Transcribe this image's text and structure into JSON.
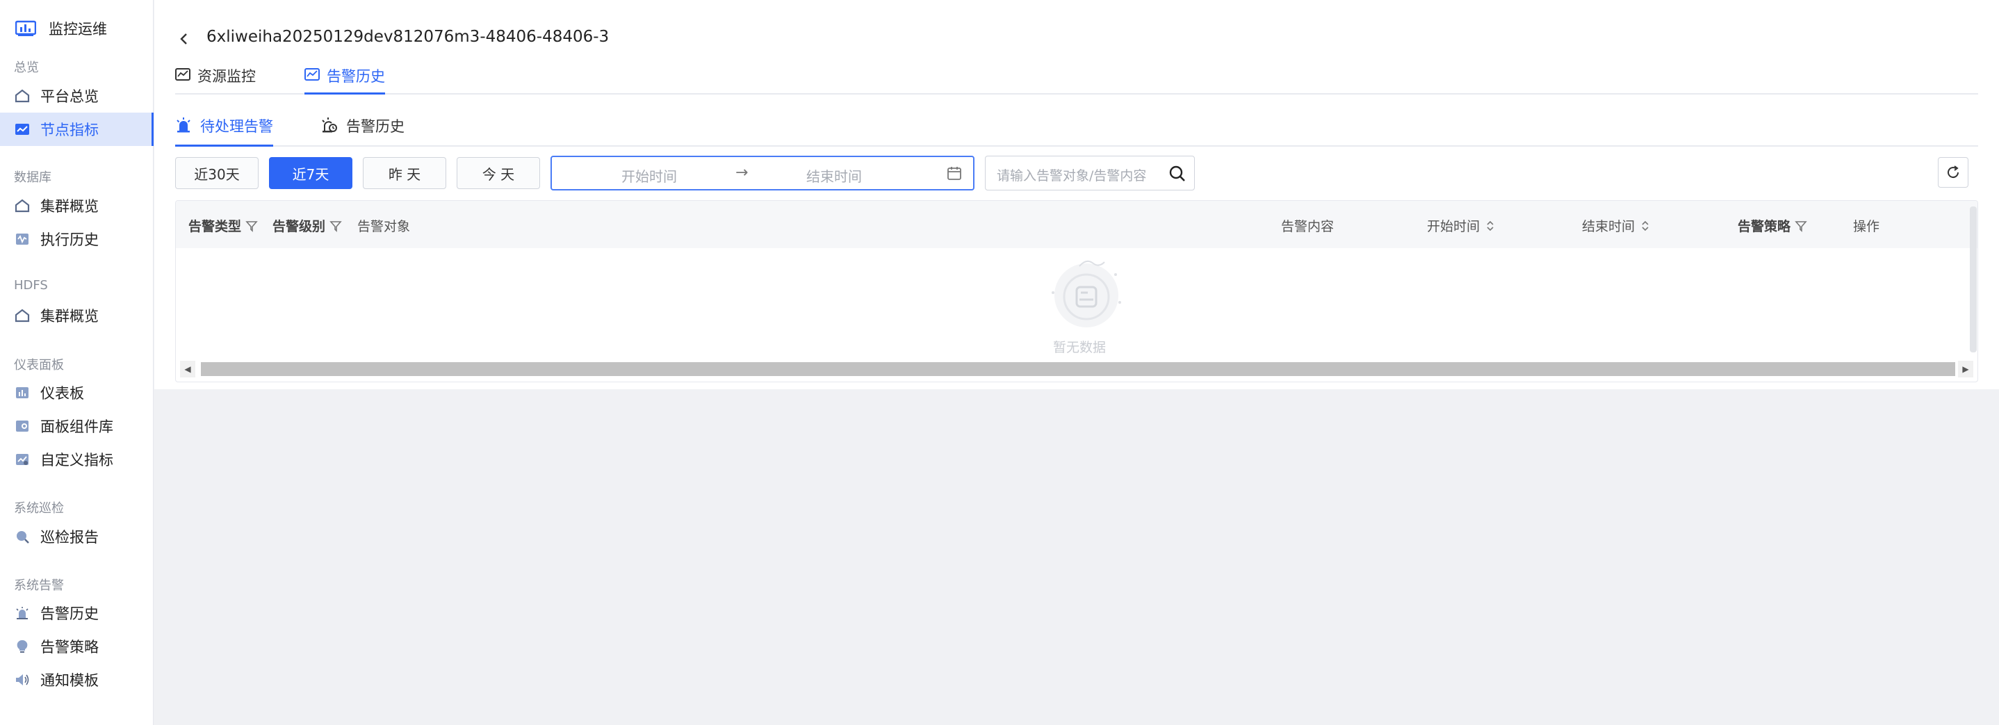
{
  "sidebar": {
    "brand": "监控运维",
    "sections": [
      {
        "title": "总览",
        "items": [
          {
            "label": "平台总览",
            "icon": "home-icon"
          },
          {
            "label": "节点指标",
            "icon": "chart-line-icon",
            "active": true
          }
        ]
      },
      {
        "title": "数据库",
        "items": [
          {
            "label": "集群概览",
            "icon": "home-icon"
          },
          {
            "label": "执行历史",
            "icon": "history-icon"
          }
        ]
      },
      {
        "title": "HDFS",
        "items": [
          {
            "label": "集群概览",
            "icon": "home-icon"
          }
        ]
      },
      {
        "title": "仪表面板",
        "items": [
          {
            "label": "仪表板",
            "icon": "dashboard-icon"
          },
          {
            "label": "面板组件库",
            "icon": "widget-icon"
          },
          {
            "label": "自定义指标",
            "icon": "custom-metric-icon"
          }
        ]
      },
      {
        "title": "系统巡检",
        "items": [
          {
            "label": "巡检报告",
            "icon": "magnifier-icon"
          }
        ]
      },
      {
        "title": "系统告警",
        "items": [
          {
            "label": "告警历史",
            "icon": "alarm-icon"
          },
          {
            "label": "告警策略",
            "icon": "bulb-icon"
          },
          {
            "label": "通知模板",
            "icon": "speaker-icon"
          }
        ]
      }
    ]
  },
  "header": {
    "title": "6xliweiha20250129dev812076m3-48406-48406-3"
  },
  "tabs": [
    {
      "label": "资源监控",
      "active": false
    },
    {
      "label": "告警历史",
      "active": true
    }
  ],
  "subtabs": [
    {
      "label": "待处理告警",
      "active": true
    },
    {
      "label": "告警历史",
      "active": false
    }
  ],
  "filters": {
    "ranges": [
      "近30天",
      "近7天",
      "昨 天",
      "今 天"
    ],
    "selected": "近7天",
    "start_placeholder": "开始时间",
    "arrow": "→",
    "end_placeholder": "结束时间",
    "search_placeholder": "请输入告警对象/告警内容"
  },
  "table": {
    "columns": [
      "告警类型",
      "告警级别",
      "告警对象",
      "告警内容",
      "开始时间",
      "结束时间",
      "告警策略",
      "操作"
    ],
    "rows": [],
    "empty_text": "暂无数据"
  },
  "colors": {
    "accent": "#2d66f5",
    "active_bg": "#dde6fb"
  }
}
